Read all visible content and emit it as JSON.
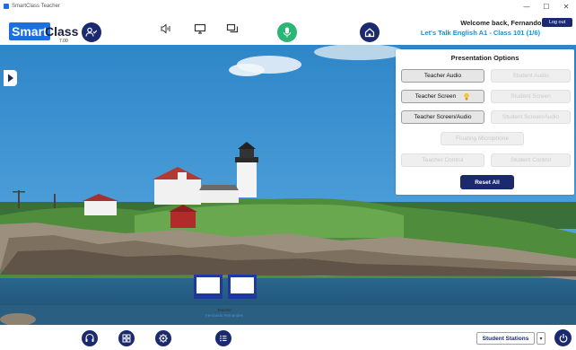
{
  "window": {
    "title": "SmartClass Teacher",
    "minimize_glyph": "—",
    "maximize_glyph": "☐",
    "close_glyph": "✕"
  },
  "logo": {
    "smart": "Smart",
    "class": "Class",
    "version": "7.00"
  },
  "header": {
    "welcome": "Welcome back, Fernando!",
    "class_name": "Let's Talk English A1 - Class 101 (1/6)",
    "logout_label": "Log out",
    "icons": [
      "users-icon",
      "speaker-icon",
      "monitor-icon",
      "chat-icon",
      "microphone-icon",
      "home-icon"
    ],
    "mic_active_color": "#2ab673",
    "accent_color": "#1b2a6e"
  },
  "panel": {
    "title": "Presentation Options",
    "buttons": [
      {
        "label": "Teacher Audio",
        "enabled": true
      },
      {
        "label": "Student Audio",
        "enabled": false
      },
      {
        "label": "Teacher Screen",
        "enabled": true
      },
      {
        "label": "Student Screen",
        "enabled": false
      },
      {
        "label": "Teacher Screen/Audio",
        "enabled": true
      },
      {
        "label": "Student Screen/Audio",
        "enabled": false
      },
      {
        "label": "Floating Microphone",
        "enabled": false
      },
      {
        "label": "Teacher Control",
        "enabled": false
      },
      {
        "label": "Student Control",
        "enabled": false
      }
    ],
    "reset_label": "Reset All"
  },
  "stage": {
    "monitor_label": "Teacher",
    "monitor_sublabel": "Fernando Fernandes"
  },
  "bottom": {
    "icons": [
      "headset-icon",
      "grid-icon",
      "settings-icon",
      "list-icon"
    ],
    "stations_label": "Student Stations",
    "dropdown_glyph": "▾"
  }
}
